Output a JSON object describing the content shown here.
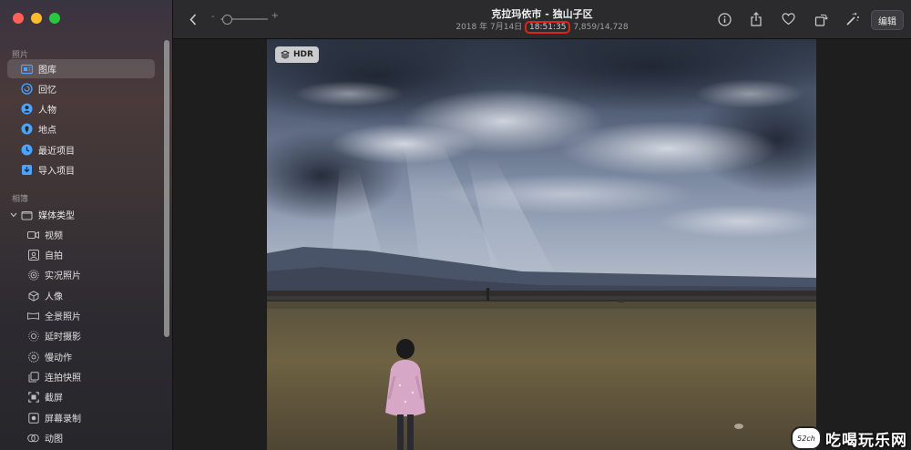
{
  "sidebar": {
    "section_photos": "照片",
    "items": [
      {
        "label": "图库",
        "icon": "library-icon",
        "active": true
      },
      {
        "label": "回忆",
        "icon": "memories-icon"
      },
      {
        "label": "人物",
        "icon": "people-icon"
      },
      {
        "label": "地点",
        "icon": "places-icon"
      },
      {
        "label": "最近项目",
        "icon": "recents-icon"
      },
      {
        "label": "导入项目",
        "icon": "imports-icon"
      }
    ],
    "section_albums": "相簿",
    "group": {
      "label": "媒体类型",
      "icon": "folder-icon"
    },
    "sub_items": [
      {
        "label": "视频",
        "icon": "video-icon"
      },
      {
        "label": "自拍",
        "icon": "selfie-icon"
      },
      {
        "label": "实况照片",
        "icon": "live-photo-icon"
      },
      {
        "label": "人像",
        "icon": "portrait-icon"
      },
      {
        "label": "全景照片",
        "icon": "panorama-icon"
      },
      {
        "label": "延时摄影",
        "icon": "timelapse-icon"
      },
      {
        "label": "慢动作",
        "icon": "slomo-icon"
      },
      {
        "label": "连拍快照",
        "icon": "burst-icon"
      },
      {
        "label": "截屏",
        "icon": "screenshot-icon"
      },
      {
        "label": "屏幕录制",
        "icon": "screen-recording-icon"
      },
      {
        "label": "动图",
        "icon": "animated-icon"
      }
    ]
  },
  "toolbar": {
    "title": "克拉玛依市 - 独山子区",
    "date": "2018 年 7月14日",
    "time": "18:51:35",
    "count": "7,859/14,728",
    "edit_label": "编辑",
    "zoom_minus": "-",
    "zoom_plus": "+"
  },
  "photo": {
    "badge": "HDR"
  },
  "watermark": {
    "logo": "52ch",
    "text": "吃喝玩乐网"
  }
}
